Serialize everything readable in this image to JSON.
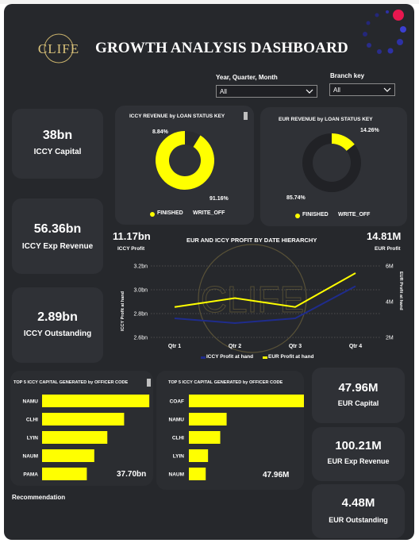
{
  "header": {
    "logo_text": "CLIFE",
    "title": "GROWTH ANALYSIS DASHBOARD",
    "dots_icon": "loading-dots-icon"
  },
  "slicers": {
    "period": {
      "label": "Year, Quarter, Month",
      "value": "All"
    },
    "branch": {
      "label": "Branch key",
      "value": "All"
    }
  },
  "kpis_left": [
    {
      "value": "38bn",
      "label": "ICCY Capital"
    },
    {
      "value": "56.36bn",
      "label": "ICCY Exp Revenue"
    },
    {
      "value": "2.89bn",
      "label": "ICCY Outstanding"
    }
  ],
  "kpis_right": [
    {
      "value": "47.96M",
      "label": "EUR Capital"
    },
    {
      "value": "100.21M",
      "label": "EUR Exp Revenue"
    },
    {
      "value": "4.48M",
      "label": "EUR Outstanding"
    }
  ],
  "donut_iccy": {
    "title": "ICCY REVENUE by LOAN STATUS KEY",
    "finished_pct": 91.16,
    "write_off_pct": 8.84,
    "finished_label": "91.16%",
    "write_off_label": "8.84%",
    "legend": [
      "FINISHED",
      "WRITE_OFF"
    ]
  },
  "donut_eur": {
    "title": "EUR REVENUE by LOAN STATUS KEY",
    "finished_pct": 14.26,
    "write_off_pct": 85.74,
    "finished_label": "14.26%",
    "write_off_label": "85.74%",
    "legend": [
      "FINISHED",
      "WRITE_OFF"
    ]
  },
  "profit": {
    "title": "EUR AND ICCY PROFIT BY DATE HIERARCHY",
    "iccy_total": "11.17bn",
    "iccy_total_label": "ICCY Profit",
    "eur_total": "14.81M",
    "eur_total_label": "EUR Profit",
    "y_left_title": "ICCY Profit at hand",
    "y_right_title": "EUR Profit at hand",
    "y_left_ticks": [
      "3.2bn",
      "3.0bn",
      "2.8bn",
      "2.6bn"
    ],
    "y_right_ticks": [
      "6M",
      "4M",
      "2M"
    ],
    "legend": [
      "ICCY Profit at hand",
      "EUR Profit at hand"
    ],
    "watermark": "CLIFE"
  },
  "bars_iccy": {
    "title": "TOP 5 ICCY CAPITAL GENERATED by OFFICER CODE",
    "total": "37.70bn"
  },
  "bars_eur": {
    "title": "TOP 5 ICCY CAPITAL GENERATED by OFFICER CODE",
    "total": "47.96M"
  },
  "recommendation": {
    "label": "Recommendation"
  },
  "colors": {
    "accent": "#ffff00",
    "iccy_line": "#1f2c8c",
    "background": "#26282c",
    "card": "#2f3136"
  },
  "chart_data": [
    {
      "type": "pie",
      "title": "ICCY REVENUE by LOAN STATUS KEY",
      "categories": [
        "FINISHED",
        "WRITE_OFF"
      ],
      "values": [
        91.16,
        8.84
      ]
    },
    {
      "type": "pie",
      "title": "EUR REVENUE by LOAN STATUS KEY",
      "categories": [
        "FINISHED",
        "WRITE_OFF"
      ],
      "values": [
        14.26,
        85.74
      ]
    },
    {
      "type": "line",
      "title": "EUR AND ICCY PROFIT BY DATE HIERARCHY",
      "x": [
        "Qtr 1",
        "Qtr 2",
        "Qtr 3",
        "Qtr 4"
      ],
      "series": [
        {
          "name": "ICCY Profit at hand",
          "axis": "left",
          "values": [
            2.76,
            2.72,
            2.76,
            3.03
          ]
        },
        {
          "name": "EUR Profit at hand",
          "axis": "right",
          "values": [
            3.7,
            4.2,
            3.7,
            5.6
          ]
        }
      ],
      "ylabel": "ICCY Profit at hand",
      "ylim": [
        2.6,
        3.2
      ],
      "y2label": "EUR Profit at hand",
      "y2lim": [
        2,
        6
      ],
      "legend": "bottom"
    },
    {
      "type": "bar",
      "orientation": "horizontal",
      "title": "TOP 5 ICCY CAPITAL GENERATED by OFFICER CODE",
      "categories": [
        "NAMU",
        "CLHI",
        "LYIN",
        "NAUM",
        "PAMA"
      ],
      "values": [
        11.5,
        8.8,
        7.0,
        5.6,
        4.8
      ],
      "max": 12
    },
    {
      "type": "bar",
      "orientation": "horizontal",
      "title": "TOP 5 ICCY CAPITAL GENERATED by OFFICER CODE",
      "categories": [
        "COAF",
        "NAMU",
        "CLHI",
        "LYIN",
        "NAUM"
      ],
      "values": [
        23.0,
        6.5,
        5.4,
        3.3,
        2.9
      ],
      "max": 25
    }
  ]
}
